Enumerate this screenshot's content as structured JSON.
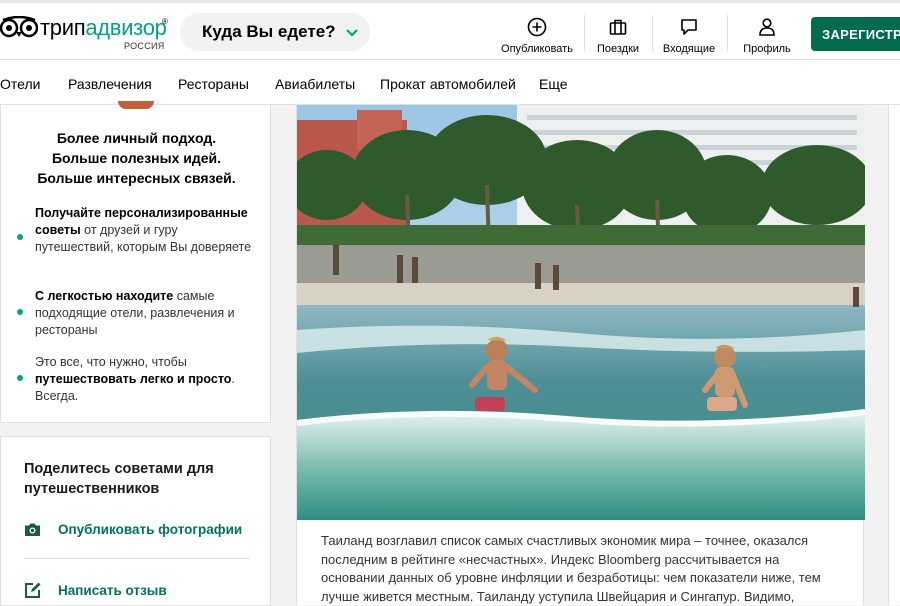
{
  "header": {
    "logo_prefix": "трип",
    "logo_suffix": "адвизор",
    "logo_reg": "®",
    "logo_country": "РОССИЯ",
    "search_label": "Куда Вы едете?",
    "nav": [
      {
        "label": "Опубликовать",
        "icon": "plus-circle-icon"
      },
      {
        "label": "Поездки",
        "icon": "suitcase-icon"
      },
      {
        "label": "Входящие",
        "icon": "speech-bubble-icon"
      },
      {
        "label": "Профиль",
        "icon": "person-icon"
      }
    ],
    "register_label": "ЗАРЕГИСТР",
    "accent": "#006a4e"
  },
  "categories": [
    "Отели",
    "Развлечения",
    "Рестораны",
    "Авиабилеты",
    "Прокат автомобилей",
    "Еще"
  ],
  "promo": {
    "title_lines": [
      "Более личный подход.",
      "Больше полезных идей.",
      "Больше интересных связей."
    ],
    "benefits": [
      {
        "bold": "Получайте персонализированные советы",
        "text": " от друзей и гуру путешествий, которым Вы доверяете"
      },
      {
        "bold": "С легкостью находите",
        "text": " самые подходящие отели, развлечения и рестораны"
      },
      {
        "pre": "Это все, что нужно, чтобы ",
        "bold": "путешествовать легко и просто",
        "text": ". Всегда."
      }
    ],
    "dot_color": "#00a680"
  },
  "share": {
    "title": "Поделитесь советами для путешественников",
    "actions": [
      {
        "label": "Опубликовать фотографии",
        "icon": "camera-icon"
      },
      {
        "label": "Написать отзыв",
        "icon": "edit-icon"
      }
    ]
  },
  "article": {
    "caption": "Таиланд возглавил список самых счастливых экономик мира – точнее, оказался последним в рейтинге «несчастных». Индекс Bloomberg рассчитывается на основании данных об уровне инфляции и безработицы: чем показатели ниже, тем лучше живется местным. Таиланду уступила Швейцария и Сингапур. Видимо,"
  }
}
